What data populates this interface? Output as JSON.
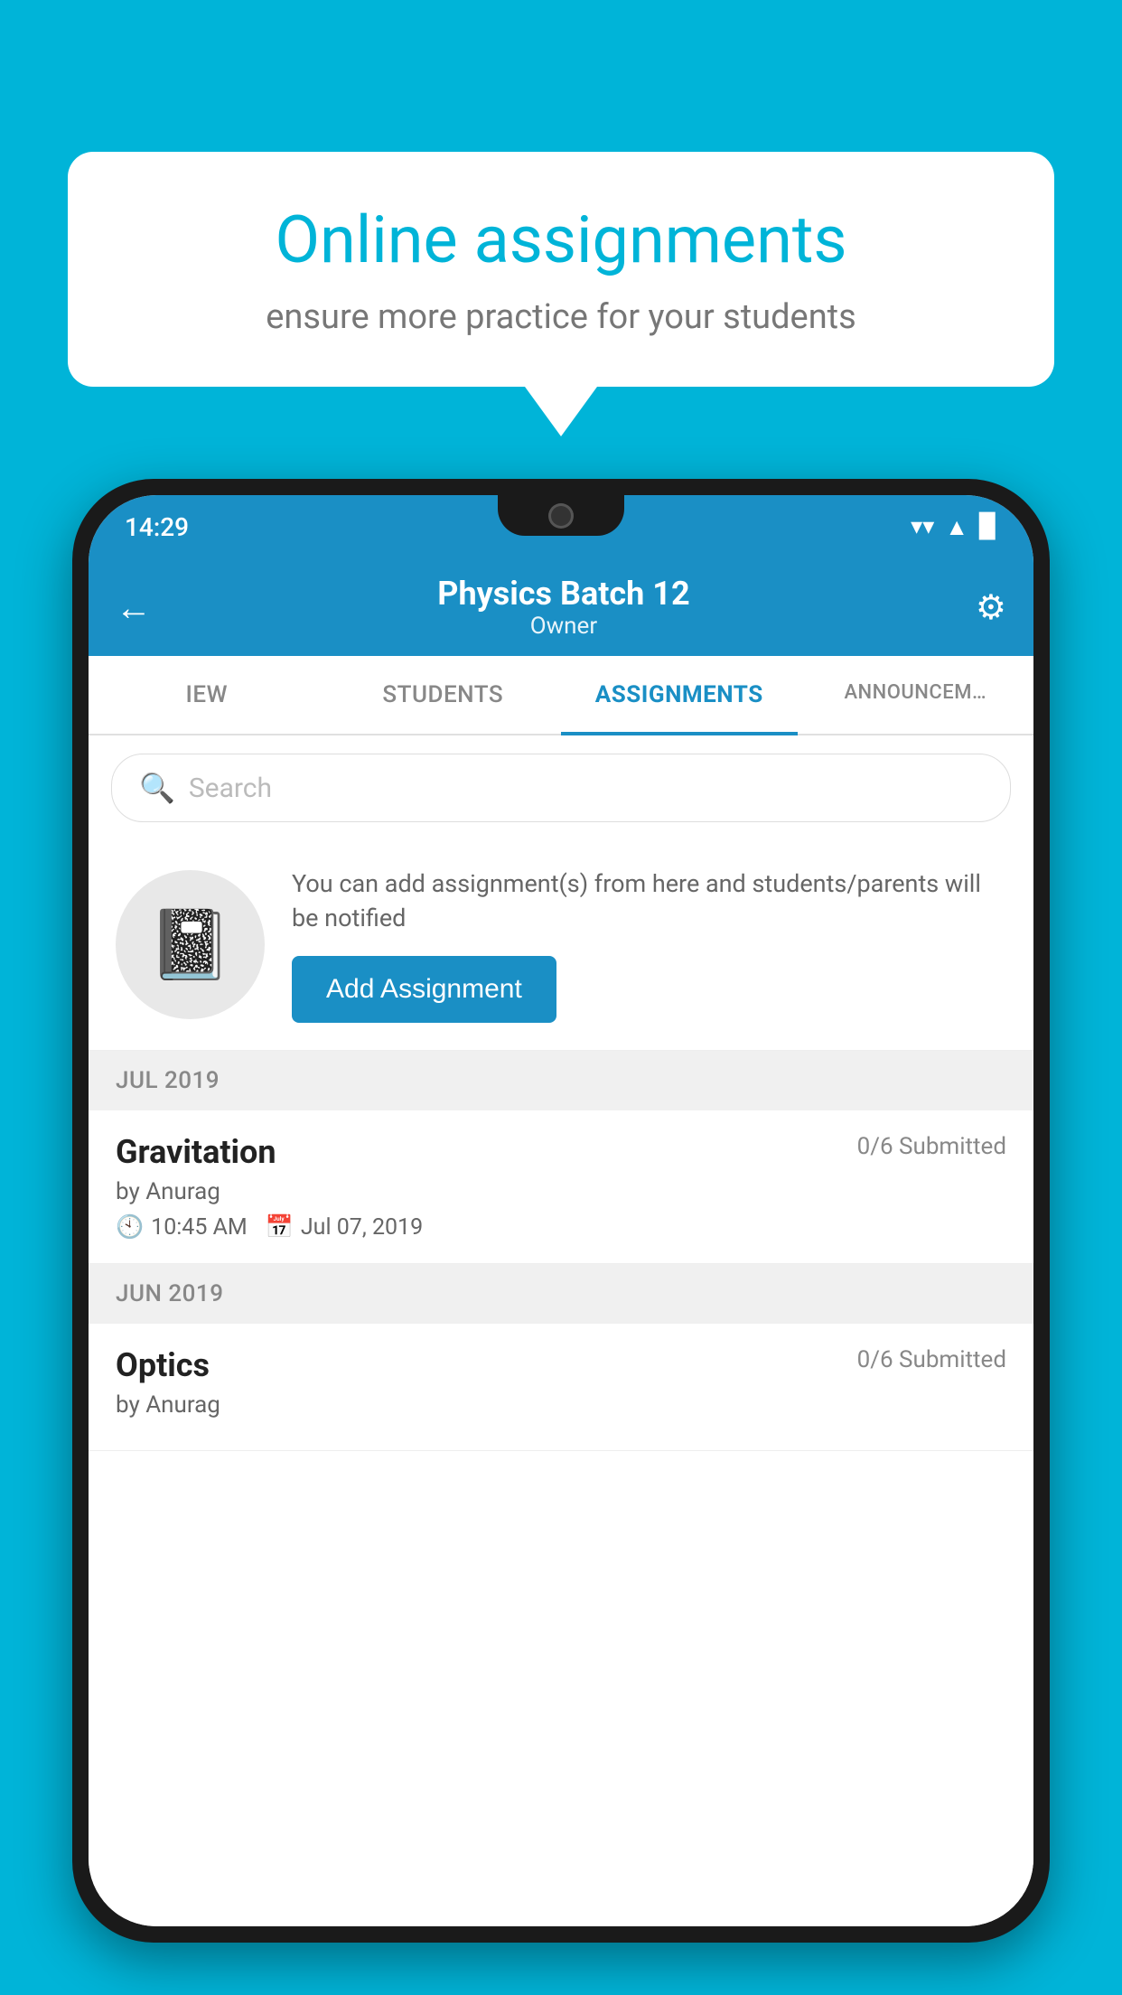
{
  "background_color": "#00b4d8",
  "speech_bubble": {
    "title": "Online assignments",
    "subtitle": "ensure more practice for your students"
  },
  "phone": {
    "status_bar": {
      "time": "14:29",
      "wifi": "▼",
      "signal": "▲",
      "battery": "▉"
    },
    "header": {
      "title": "Physics Batch 12",
      "subtitle": "Owner",
      "back_label": "←",
      "settings_label": "⚙"
    },
    "tabs": [
      {
        "label": "IEW",
        "active": false
      },
      {
        "label": "STUDENTS",
        "active": false
      },
      {
        "label": "ASSIGNMENTS",
        "active": true
      },
      {
        "label": "ANNOUNCEM…",
        "active": false
      }
    ],
    "search": {
      "placeholder": "Search"
    },
    "promo": {
      "description": "You can add assignment(s) from here and students/parents will be notified",
      "button_label": "Add Assignment"
    },
    "sections": [
      {
        "header": "JUL 2019",
        "assignments": [
          {
            "name": "Gravitation",
            "submitted": "0/6 Submitted",
            "by": "by Anurag",
            "time": "10:45 AM",
            "date": "Jul 07, 2019"
          }
        ]
      },
      {
        "header": "JUN 2019",
        "assignments": [
          {
            "name": "Optics",
            "submitted": "0/6 Submitted",
            "by": "by Anurag",
            "time": "",
            "date": ""
          }
        ]
      }
    ]
  }
}
